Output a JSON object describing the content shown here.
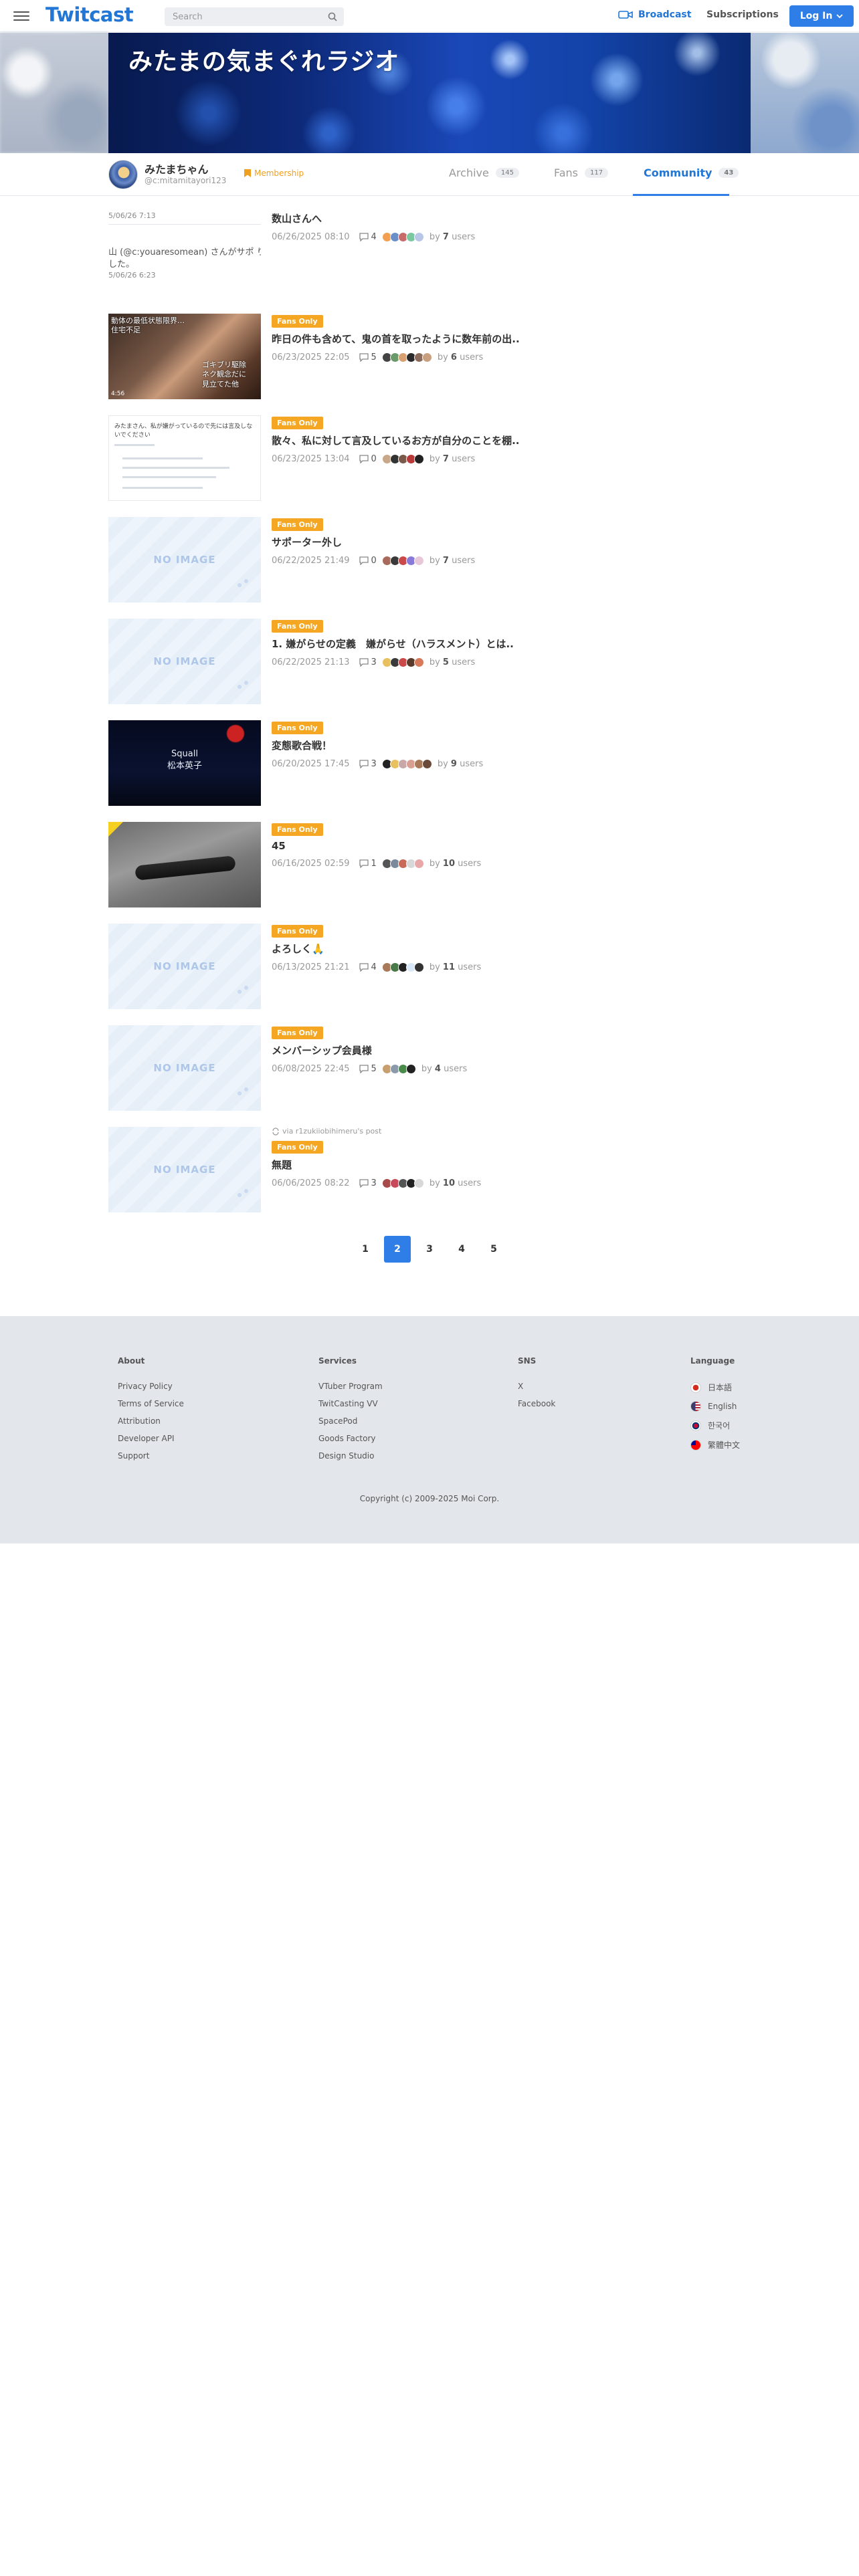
{
  "header": {
    "logo": "Twitcast",
    "search_placeholder": "Search",
    "broadcast": "Broadcast",
    "subscriptions": "Subscriptions",
    "login": "Log In"
  },
  "banner": {
    "title": "みたまの気まぐれラジオ"
  },
  "profile": {
    "name": "みたまちゃん",
    "id": "@c:mitamitayori123",
    "membership": "Membership"
  },
  "tabs": [
    {
      "label": "Archive",
      "count": "145"
    },
    {
      "label": "Fans",
      "count": "117"
    },
    {
      "label": "Community",
      "count": "43"
    }
  ],
  "sidebar": {
    "item1": {
      "date": "5/06/26 7:13"
    },
    "item2": {
      "text": "山 (@c:youaresomean) さんがサポ りました。",
      "date": "5/06/26 6:23"
    }
  },
  "posts": [
    {
      "title": "数山さんへ",
      "date": "06/26/2025 08:10",
      "comments": "4",
      "users": "7",
      "colors": [
        "#f0a050",
        "#6a8fc8",
        "#c86a6a",
        "#7ac8a0",
        "#b8c6e8"
      ]
    },
    {
      "badge": "Fans Only",
      "title": "昨日の件も含めて、鬼の首を取ったように数年前の出..",
      "date": "06/23/2025 22:05",
      "comments": "5",
      "users": "6",
      "colors": [
        "#444",
        "#6a9a6a",
        "#d8a070",
        "#2a2a2a",
        "#8a6a5a",
        "#c8a080"
      ],
      "thumb_text1": "動体の最低状態限界…\n住宅不足",
      "thumb_text2": "ゴキブリ駆除\nネク観念だに\n見立てた他",
      "thumb_time": "4:56"
    },
    {
      "badge": "Fans Only",
      "title": "散々、私に対して言及しているお方が自分のことを棚..",
      "date": "06/23/2025 13:04",
      "comments": "0",
      "users": "7",
      "colors": [
        "#c8a888",
        "#333",
        "#7a5a4a",
        "#b83a3a",
        "#222"
      ],
      "thumb_text": "みたまさん、私が嫌がっているので先には言及しないでください"
    },
    {
      "badge": "Fans Only",
      "title": "サポーター外し",
      "date": "06/22/2025 21:49",
      "comments": "0",
      "users": "7",
      "colors": [
        "#a86a5a",
        "#3a3a3a",
        "#c84a4a",
        "#8a7ad8",
        "#e8c8d8"
      ],
      "noimage": "NO IMAGE"
    },
    {
      "badge": "Fans Only",
      "title": "1. 嫌がらせの定義　嫌がらせ（ハラスメント）とは..",
      "date": "06/22/2025 21:13",
      "comments": "3",
      "users": "5",
      "colors": [
        "#e8c060",
        "#3a3a3a",
        "#c84a4a",
        "#5a3a2a",
        "#d87a5a"
      ],
      "noimage": "NO IMAGE"
    },
    {
      "badge": "Fans Only",
      "title": "変態歌合戦！",
      "date": "06/20/2025 17:45",
      "comments": "3",
      "users": "9",
      "colors": [
        "#222",
        "#e8c060",
        "#c8a8a8",
        "#d8a090",
        "#a87a5a",
        "#6a4a3a"
      ],
      "thumb_text": "Squall\n松本英子"
    },
    {
      "badge": "Fans Only",
      "title": "45",
      "date": "06/16/2025 02:59",
      "comments": "1",
      "users": "10",
      "colors": [
        "#555",
        "#7a8a9a",
        "#c86a5a",
        "#d8d8d8",
        "#e8a8a8"
      ]
    },
    {
      "badge": "Fans Only",
      "title": "よろしく🙏",
      "date": "06/13/2025 21:21",
      "comments": "4",
      "users": "11",
      "colors": [
        "#a87a5a",
        "#4a7a4a",
        "#222",
        "#d8e8f8",
        "#333"
      ],
      "noimage": "NO IMAGE"
    },
    {
      "badge": "Fans Only",
      "title": "メンバーシップ会員様",
      "date": "06/08/2025 22:45",
      "comments": "5",
      "users": "4",
      "colors": [
        "#c8a070",
        "#8a9aaa",
        "#4a8a4a",
        "#222"
      ],
      "noimage": "NO IMAGE"
    },
    {
      "via": "via r1zukiiobihimeru's post",
      "badge": "Fans Only",
      "title": "無題",
      "date": "06/06/2025 08:22",
      "comments": "3",
      "users": "10",
      "colors": [
        "#a84a4a",
        "#c84a5a",
        "#555",
        "#222",
        "#d8d8d8"
      ],
      "noimage": "NO IMAGE"
    }
  ],
  "users_prefix": "by",
  "users_suffix": "users",
  "pagination": [
    "1",
    "2",
    "3",
    "4",
    "5"
  ],
  "pagination_active": "2",
  "footer": {
    "about": {
      "head": "About",
      "links": [
        "Privacy Policy",
        "Terms of Service",
        "Attribution",
        "Developer API",
        "Support"
      ]
    },
    "services": {
      "head": "Services",
      "links": [
        "VTuber Program",
        "TwitCasting VV",
        "SpacePod",
        "Goods Factory",
        "Design Studio"
      ]
    },
    "sns": {
      "head": "SNS",
      "links": [
        "X",
        "Facebook"
      ]
    },
    "language": {
      "head": "Language",
      "links": [
        "日本語",
        "English",
        "한국어",
        "繁體中文"
      ]
    },
    "copyright": "Copyright (c) 2009-2025 Moi Corp."
  },
  "colors": {
    "accent": "#2f7ee8",
    "badge": "#f5a623",
    "membership": "#f0a020"
  }
}
